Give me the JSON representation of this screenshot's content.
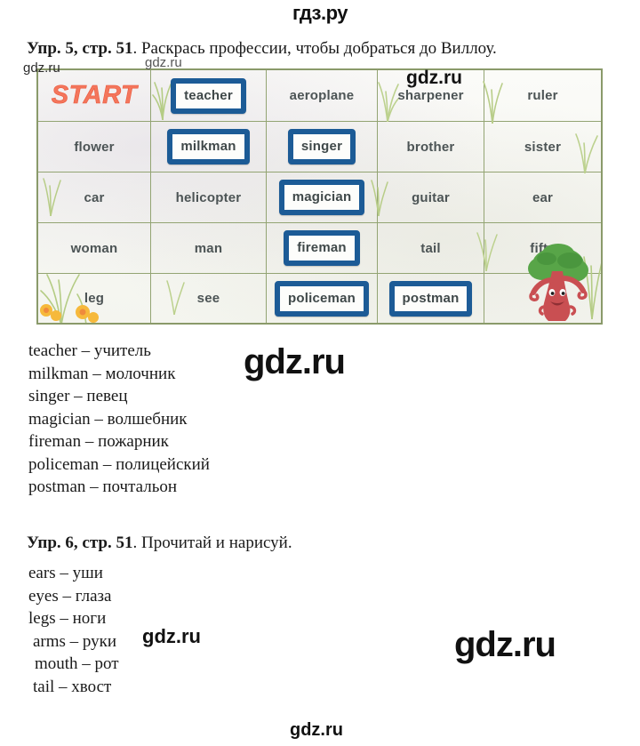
{
  "site": {
    "logo": "гдз.ру"
  },
  "watermarks": [
    {
      "id": "wm-a",
      "text": "gdz.ru"
    },
    {
      "id": "wm-b",
      "text": "gdz.ru"
    },
    {
      "id": "wm-c",
      "text": "gdz.ru"
    },
    {
      "id": "wm-d",
      "text": "gdz.ru"
    },
    {
      "id": "wm-e",
      "text": "gdz.ru"
    },
    {
      "id": "wm-f",
      "text": "gdz.ru"
    },
    {
      "id": "wm-g",
      "text": "gdz.ru"
    }
  ],
  "exercise5": {
    "label": "Упр. 5, стр. 51",
    "task": ". Раскрась профессии, чтобы добраться до Виллоу.",
    "board": {
      "start_label": "START",
      "rows": [
        [
          {
            "text": "START",
            "type": "start",
            "marked": false
          },
          {
            "text": "teacher",
            "type": "word",
            "marked": true
          },
          {
            "text": "aeroplane",
            "type": "word",
            "marked": false
          },
          {
            "text": "sharpener",
            "type": "word",
            "marked": false
          },
          {
            "text": "ruler",
            "type": "word",
            "marked": false
          }
        ],
        [
          {
            "text": "flower",
            "type": "word",
            "marked": false
          },
          {
            "text": "milkman",
            "type": "word",
            "marked": true
          },
          {
            "text": "singer",
            "type": "word",
            "marked": true
          },
          {
            "text": "brother",
            "type": "word",
            "marked": false
          },
          {
            "text": "sister",
            "type": "word",
            "marked": false
          }
        ],
        [
          {
            "text": "car",
            "type": "word",
            "marked": false
          },
          {
            "text": "helicopter",
            "type": "word",
            "marked": false
          },
          {
            "text": "magician",
            "type": "word",
            "marked": true
          },
          {
            "text": "guitar",
            "type": "word",
            "marked": false
          },
          {
            "text": "ear",
            "type": "word",
            "marked": false
          }
        ],
        [
          {
            "text": "woman",
            "type": "word",
            "marked": false
          },
          {
            "text": "man",
            "type": "word",
            "marked": false
          },
          {
            "text": "fireman",
            "type": "word",
            "marked": true
          },
          {
            "text": "tail",
            "type": "word",
            "marked": false
          },
          {
            "text": "fifty",
            "type": "word",
            "marked": false
          }
        ],
        [
          {
            "text": "leg",
            "type": "word",
            "marked": false
          },
          {
            "text": "see",
            "type": "word",
            "marked": false
          },
          {
            "text": "policeman",
            "type": "word",
            "marked": true
          },
          {
            "text": "postman",
            "type": "word",
            "marked": true
          },
          {
            "text": "",
            "type": "empty",
            "marked": false
          }
        ]
      ],
      "colors": {
        "marked_border": "#1c5b96",
        "grid_line": "#93a473",
        "board_border": "#8a9a6a",
        "start_text": "#f4765c",
        "word_text": "#4c5455"
      },
      "character": "willow-tree-character"
    },
    "words": [
      "teacher – учитель",
      "milkman – молочник",
      "singer – певец",
      "magician – волшебник",
      "fireman – пожарник",
      "policeman – полицейский",
      "postman – почтальон"
    ]
  },
  "exercise6": {
    "label": "Упр. 6, стр. 51",
    "task": ". Прочитай и нарисуй.",
    "words": [
      "ears – уши",
      "eyes – глаза",
      "legs – ноги",
      "arms – руки",
      "mouth – рот",
      "tail – хвост"
    ]
  }
}
